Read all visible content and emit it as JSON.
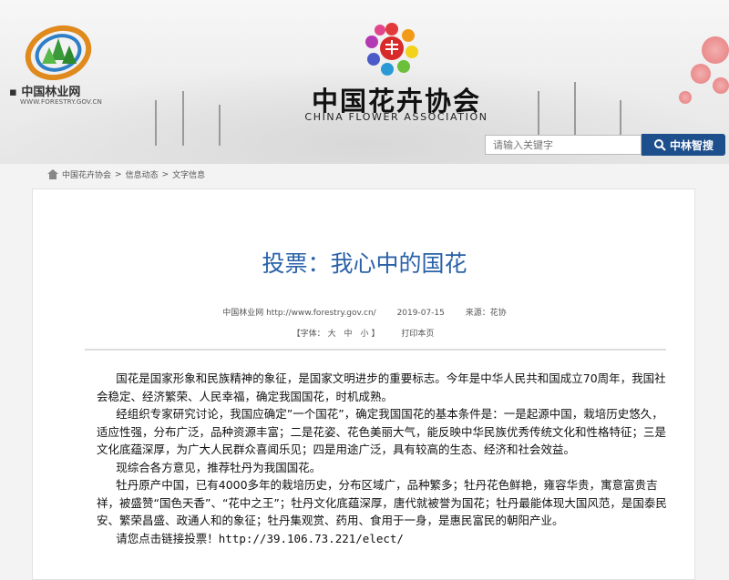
{
  "header": {
    "site_name": "中国林业网",
    "site_url": "WWW.FORESTRY.GOV.CN",
    "org_title": "中国花卉协会",
    "org_title_en": "CHINA FLOWER ASSOCIATION",
    "search_placeholder": "请输入关键字",
    "search_button": "中林智搜"
  },
  "breadcrumb": [
    "中国花卉协会",
    "信息动态",
    "文字信息"
  ],
  "breadcrumb_sep": ">",
  "article": {
    "title": "投票：我心中的国花",
    "source": "中国林业网 http://www.forestry.gov.cn/",
    "date": "2019-07-15",
    "origin": "来源：花协",
    "font_label": "【字体：",
    "font_large": "大",
    "font_medium": "中",
    "font_small": "小",
    "font_close": "】",
    "print_label": "打印本页",
    "paragraphs": [
      "国花是国家形象和民族精神的象征，是国家文明进步的重要标志。今年是中华人民共和国成立70周年，我国社会稳定、经济繁荣、人民幸福，确定我国国花，时机成熟。",
      "经组织专家研究讨论，我国应确定”一个国花”，确定我国国花的基本条件是：一是起源中国，栽培历史悠久，适应性强，分布广泛，品种资源丰富；二是花姿、花色美丽大气，能反映中华民族优秀传统文化和性格特征；三是文化底蕴深厚，为广大人民群众喜闻乐见；四是用途广泛，具有较高的生态、经济和社会效益。",
      "现综合各方意见，推荐牡丹为我国国花。",
      "牡丹原产中国，已有4000多年的栽培历史，分布区域广，品种繁多；牡丹花色鲜艳，雍容华贵，寓意富贵吉祥，被盛赞“国色天香”、“花中之王”；牡丹文化底蕴深厚，唐代就被誉为国花；牡丹最能体现大国风范，是国泰民安、繁荣昌盛、政通人和的象征；牡丹集观赏、药用、食用于一身，是惠民富民的朝阳产业。"
    ],
    "vote_prefix": "请您点击链接投票！",
    "vote_url": "http://39.106.73.221/elect/"
  },
  "colors": {
    "title_blue": "#2a62a8",
    "search_button_bg": "#1d4f8c"
  }
}
